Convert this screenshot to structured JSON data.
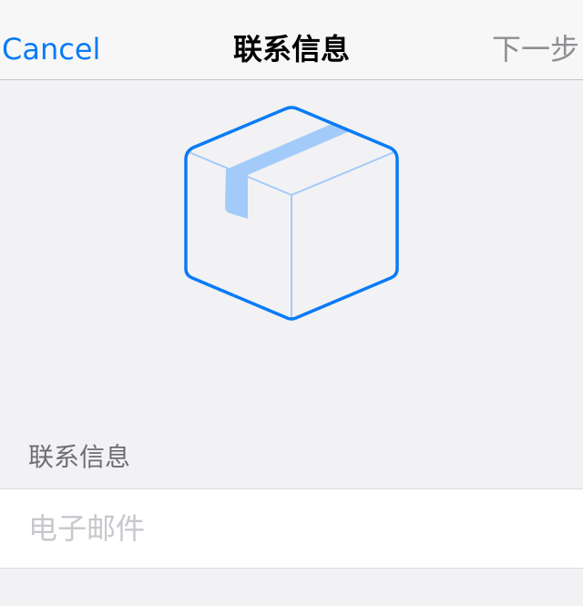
{
  "nav": {
    "cancel_label": "Cancel",
    "title": "联系信息",
    "next_label": "下一步"
  },
  "illustration": {
    "icon": "package-box-icon",
    "stroke_color": "#0a7bf6",
    "tape_color": "#a3cbfa"
  },
  "contact_section": {
    "header": "联系信息",
    "email_placeholder": "电子邮件",
    "email_value": ""
  },
  "colors": {
    "accent": "#0a7bf6",
    "disabled": "#8e8e93",
    "background": "#f2f2f4"
  }
}
